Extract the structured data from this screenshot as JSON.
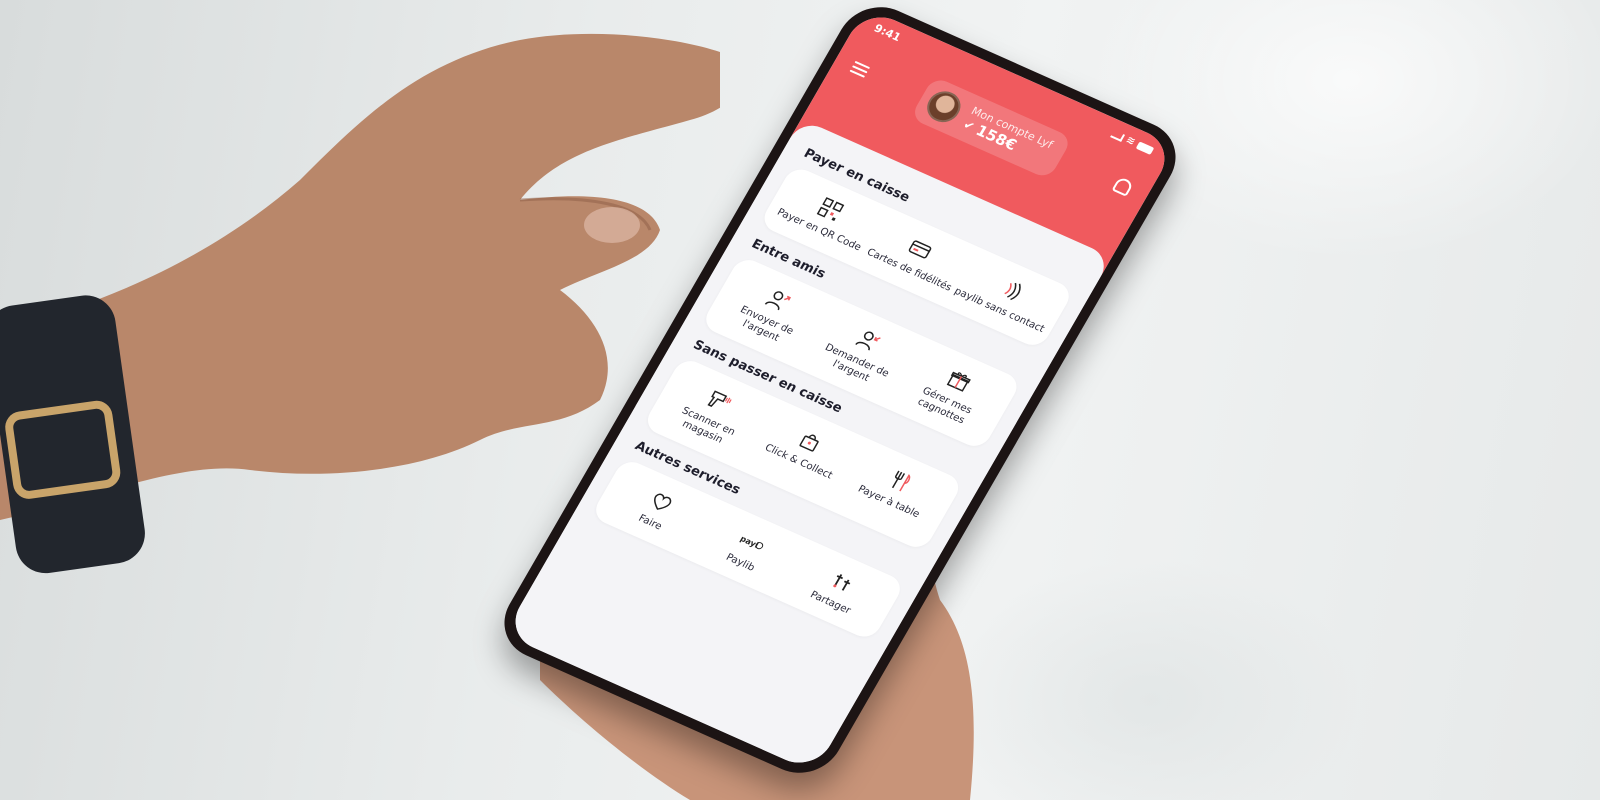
{
  "status_bar": {
    "time": "9:41"
  },
  "header": {
    "account_title": "Mon compte Lyf",
    "balance": "158€"
  },
  "sections": [
    {
      "title": "Payer en caisse",
      "items": [
        {
          "label": "Payer en QR Code",
          "icon": "qr-code-icon"
        },
        {
          "label": "Cartes de fidélités",
          "icon": "loyalty-card-icon"
        },
        {
          "label": "paylib sans contact",
          "icon": "contactless-icon"
        }
      ]
    },
    {
      "title": "Entre amis",
      "items": [
        {
          "label": "Envoyer de l'argent",
          "icon": "send-money-icon"
        },
        {
          "label": "Demander de l'argent",
          "icon": "request-money-icon"
        },
        {
          "label": "Gérer mes cagnottes",
          "icon": "gift-icon"
        }
      ]
    },
    {
      "title": "Sans passer en caisse",
      "items": [
        {
          "label": "Scanner en magasin",
          "icon": "scanner-icon"
        },
        {
          "label": "Click & Collect",
          "icon": "shopping-bag-icon"
        },
        {
          "label": "Payer à table",
          "icon": "cutlery-icon"
        }
      ]
    },
    {
      "title": "Autres services",
      "items": [
        {
          "label": "Faire",
          "icon": "heart-icon"
        },
        {
          "label": "Paylib",
          "icon": "paylib-icon"
        },
        {
          "label": "Partager",
          "icon": "share-icon"
        }
      ]
    }
  ],
  "colors": {
    "brand": "#f05a5e",
    "background": "#f4f4f7",
    "text": "#1d1d2b"
  }
}
